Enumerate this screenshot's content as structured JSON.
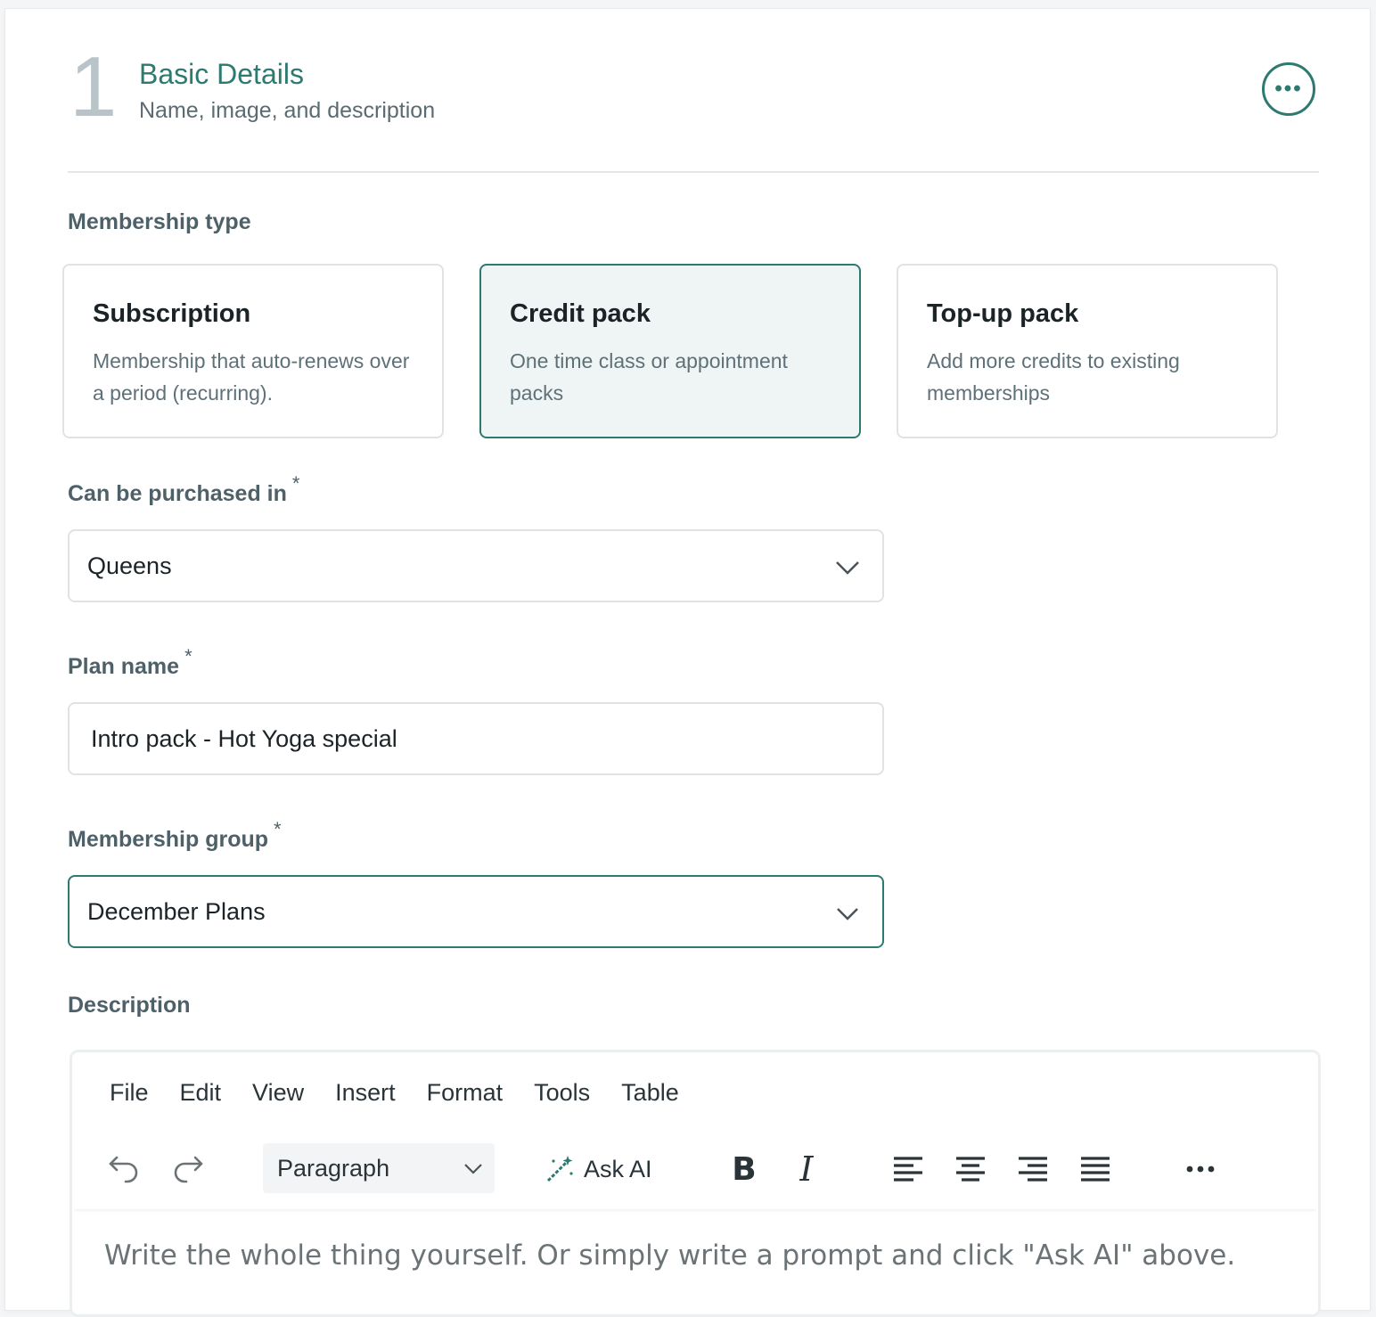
{
  "step": {
    "number": "1",
    "title": "Basic Details",
    "subtitle": "Name, image, and description",
    "more_icon": "ellipsis-icon"
  },
  "membership_type": {
    "label": "Membership type",
    "options": [
      {
        "title": "Subscription",
        "description": "Membership that auto-renews over a period (recurring).",
        "selected": false
      },
      {
        "title": "Credit pack",
        "description": "One time class or appointment packs",
        "selected": true
      },
      {
        "title": "Top-up pack",
        "description": "Add more credits to existing memberships",
        "selected": false
      }
    ]
  },
  "purchase_location": {
    "label": "Can be purchased in",
    "required_mark": "*",
    "value": "Queens"
  },
  "plan_name": {
    "label": "Plan name",
    "required_mark": "*",
    "value": "Intro pack - Hot Yoga special"
  },
  "membership_group": {
    "label": "Membership group",
    "required_mark": "*",
    "value": "December Plans"
  },
  "description": {
    "label": "Description",
    "menu": [
      "File",
      "Edit",
      "View",
      "Insert",
      "Format",
      "Tools",
      "Table"
    ],
    "block_format": "Paragraph",
    "ask_ai_label": "Ask AI",
    "placeholder": "Write the whole thing yourself. Or simply write a prompt and click \"Ask AI\" above."
  },
  "colors": {
    "accent": "#2c7a70",
    "selected_bg": "#eff4f4",
    "border": "#dfe3e5"
  }
}
